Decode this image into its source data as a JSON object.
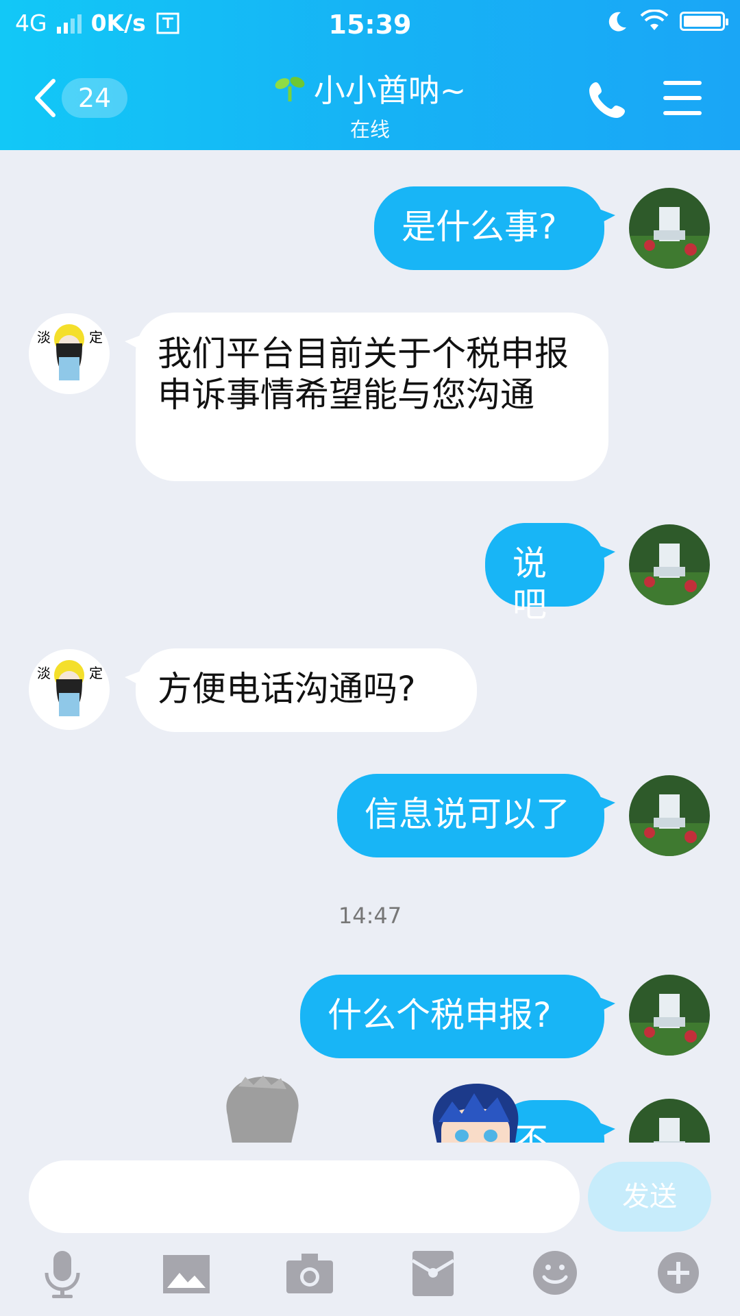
{
  "status_bar": {
    "network": "4G",
    "speed": "0K/s",
    "time": "15:39"
  },
  "header": {
    "unread_count": "24",
    "contact_name": "小小酋呐~",
    "contact_status": "在线"
  },
  "messages": [
    {
      "side": "me",
      "text": "是什么事?"
    },
    {
      "side": "them",
      "text": "我们平台目前关于个税申报 申诉事情希望能与您沟通"
    },
    {
      "side": "me",
      "text": "说吧"
    },
    {
      "side": "them",
      "text": "方便电话沟通吗?"
    },
    {
      "side": "me",
      "text": "信息说可以了"
    },
    {
      "side": "time",
      "text": "14:47"
    },
    {
      "side": "me",
      "text": "什么个税申报?"
    },
    {
      "side": "me",
      "text": "不懂"
    }
  ],
  "input": {
    "placeholder": "",
    "send_label": "发送"
  },
  "toolbar_icons": [
    "microphone-icon",
    "image-icon",
    "camera-icon",
    "red-packet-icon",
    "emoji-icon",
    "plus-icon"
  ],
  "colors": {
    "header": "#16b3f5",
    "my_bubble": "#18b5f6",
    "their_bubble": "#ffffff",
    "background": "#ebeef5"
  }
}
